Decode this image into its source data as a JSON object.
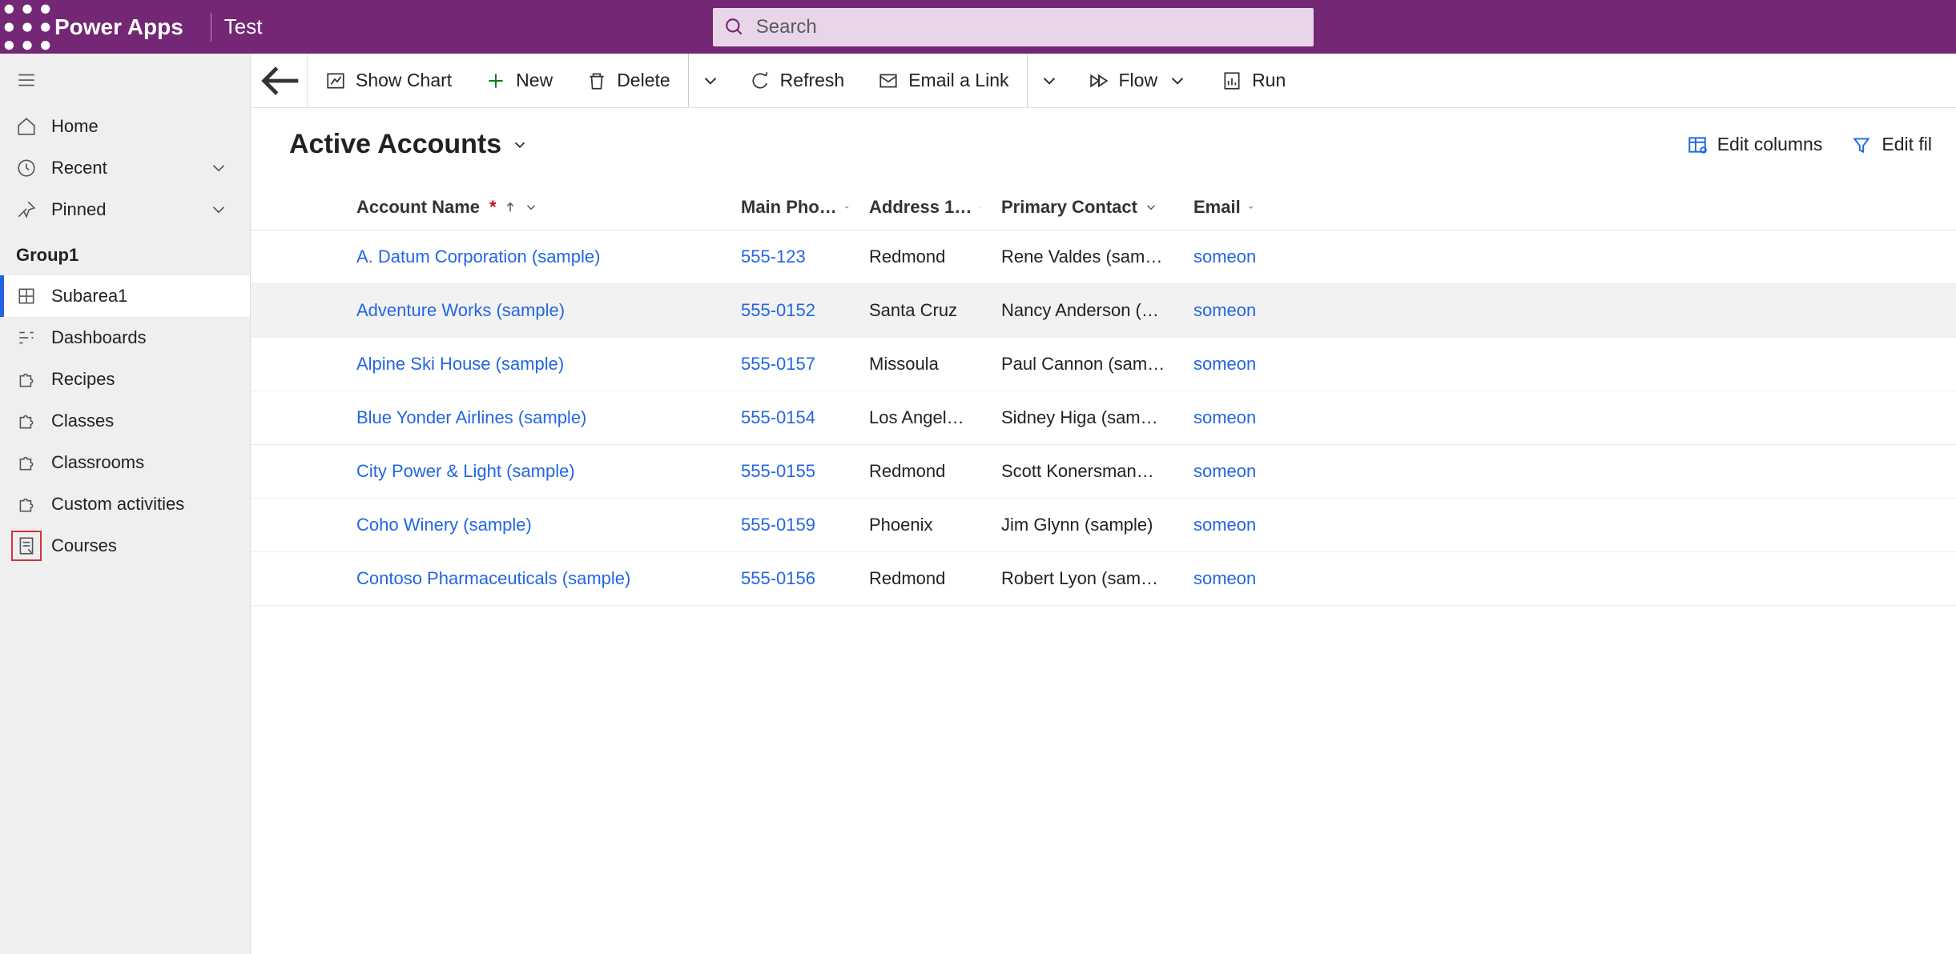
{
  "header": {
    "app_name": "Power Apps",
    "env_name": "Test",
    "search_placeholder": "Search"
  },
  "sidebar": {
    "top": {
      "home": "Home",
      "recent": "Recent",
      "pinned": "Pinned"
    },
    "group_label": "Group1",
    "items": [
      {
        "label": "Subarea1",
        "icon": "subarea",
        "active": true
      },
      {
        "label": "Dashboards",
        "icon": "dashboard"
      },
      {
        "label": "Recipes",
        "icon": "puzzle"
      },
      {
        "label": "Classes",
        "icon": "puzzle"
      },
      {
        "label": "Classrooms",
        "icon": "puzzle"
      },
      {
        "label": "Custom activities",
        "icon": "puzzle"
      },
      {
        "label": "Courses",
        "icon": "form",
        "highlight": true
      }
    ]
  },
  "commandbar": {
    "show_chart": "Show Chart",
    "new": "New",
    "delete": "Delete",
    "refresh": "Refresh",
    "email_link": "Email a Link",
    "flow": "Flow",
    "run": "Run"
  },
  "view": {
    "title": "Active Accounts",
    "edit_columns": "Edit columns",
    "edit_filters": "Edit fil"
  },
  "columns": {
    "account_name": "Account Name",
    "main_phone": "Main Pho…",
    "address_city": "Address 1…",
    "primary_contact": "Primary Contact",
    "email": "Email"
  },
  "rows": [
    {
      "name": "A. Datum Corporation (sample)",
      "phone": "555-123",
      "city": "Redmond",
      "contact": "Rene Valdes (sam…",
      "email": "someon"
    },
    {
      "name": "Adventure Works (sample)",
      "phone": "555-0152",
      "city": "Santa Cruz",
      "contact": "Nancy Anderson (…",
      "email": "someon",
      "hovered": true
    },
    {
      "name": "Alpine Ski House (sample)",
      "phone": "555-0157",
      "city": "Missoula",
      "contact": "Paul Cannon (sam…",
      "email": "someon"
    },
    {
      "name": "Blue Yonder Airlines (sample)",
      "phone": "555-0154",
      "city": "Los Angel…",
      "contact": "Sidney Higa (sam…",
      "email": "someon"
    },
    {
      "name": "City Power & Light (sample)",
      "phone": "555-0155",
      "city": "Redmond",
      "contact": "Scott Konersman…",
      "email": "someon"
    },
    {
      "name": "Coho Winery (sample)",
      "phone": "555-0159",
      "city": "Phoenix",
      "contact": "Jim Glynn (sample)",
      "email": "someon"
    },
    {
      "name": "Contoso Pharmaceuticals (sample)",
      "phone": "555-0156",
      "city": "Redmond",
      "contact": "Robert Lyon (sam…",
      "email": "someon"
    }
  ]
}
